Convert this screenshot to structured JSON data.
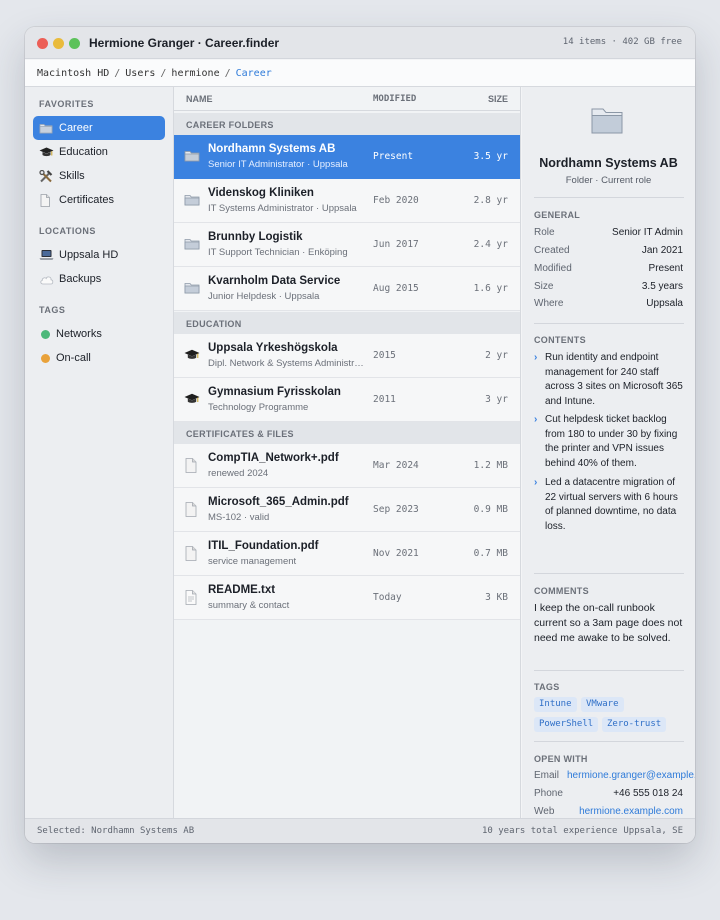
{
  "window": {
    "title": "Hermione Granger · Career.finder",
    "meta": "14 items · 402 GB free"
  },
  "path": {
    "segments": [
      "Macintosh HD",
      "Users",
      "hermione"
    ],
    "current": "Career"
  },
  "sidebar": {
    "favorites_label": "FAVORITES",
    "favorites": [
      {
        "label": "Career",
        "icon": "folder-icon"
      },
      {
        "label": "Education",
        "icon": "graduation-cap-icon"
      },
      {
        "label": "Skills",
        "icon": "tools-icon"
      },
      {
        "label": "Certificates",
        "icon": "document-icon"
      }
    ],
    "locations_label": "LOCATIONS",
    "locations": [
      {
        "label": "Uppsala HD",
        "icon": "laptop-icon"
      },
      {
        "label": "Backups",
        "icon": "cloud-icon"
      }
    ],
    "tags_label": "TAGS",
    "tags": [
      {
        "label": "Networks",
        "color": "#4cb87a"
      },
      {
        "label": "On-call",
        "color": "#e9a23b"
      }
    ]
  },
  "columns": {
    "name": "NAME",
    "modified": "MODIFIED",
    "size": "SIZE"
  },
  "sections": [
    {
      "label": "CAREER FOLDERS",
      "rows": [
        {
          "icon": "folder-icon",
          "name": "Nordhamn Systems AB",
          "sub": "Senior IT Administrator · Uppsala",
          "modified": "Present",
          "size": "3.5 yr"
        },
        {
          "icon": "folder-icon",
          "name": "Videnskog Kliniken",
          "sub": "IT Systems Administrator · Uppsala",
          "modified": "Feb 2020",
          "size": "2.8 yr"
        },
        {
          "icon": "folder-icon",
          "name": "Brunnby Logistik",
          "sub": "IT Support Technician · Enköping",
          "modified": "Jun 2017",
          "size": "2.4 yr"
        },
        {
          "icon": "folder-icon",
          "name": "Kvarnholm Data Service",
          "sub": "Junior Helpdesk · Uppsala",
          "modified": "Aug 2015",
          "size": "1.6 yr"
        }
      ]
    },
    {
      "label": "EDUCATION",
      "rows": [
        {
          "icon": "graduation-cap-icon",
          "name": "Uppsala Yrkeshögskola",
          "sub": "Dipl. Network & Systems Administration",
          "modified": "2015",
          "size": "2 yr"
        },
        {
          "icon": "graduation-cap-icon",
          "name": "Gymnasium Fyrisskolan",
          "sub": "Technology Programme",
          "modified": "2011",
          "size": "3 yr"
        }
      ]
    },
    {
      "label": "CERTIFICATES & FILES",
      "rows": [
        {
          "icon": "pdf-file-icon",
          "name": "CompTIA_Network+.pdf",
          "sub": "renewed 2024",
          "modified": "Mar 2024",
          "size": "1.2 MB"
        },
        {
          "icon": "pdf-file-icon",
          "name": "Microsoft_365_Admin.pdf",
          "sub": "MS-102 · valid",
          "modified": "Sep 2023",
          "size": "0.9 MB"
        },
        {
          "icon": "pdf-file-icon",
          "name": "ITIL_Foundation.pdf",
          "sub": "service management",
          "modified": "Nov 2021",
          "size": "0.7 MB"
        },
        {
          "icon": "text-file-icon",
          "name": "README.txt",
          "sub": "summary & contact",
          "modified": "Today",
          "size": "3 KB"
        }
      ]
    }
  ],
  "detail": {
    "title": "Nordhamn Systems AB",
    "subtitle": "Folder · Current role",
    "general_label": "GENERAL",
    "general": [
      {
        "k": "Role",
        "v": "Senior IT Admin"
      },
      {
        "k": "Created",
        "v": "Jan 2021"
      },
      {
        "k": "Modified",
        "v": "Present"
      },
      {
        "k": "Size",
        "v": "3.5 years"
      },
      {
        "k": "Where",
        "v": "Uppsala"
      }
    ],
    "contents_label": "CONTENTS",
    "contents": [
      "Run identity and endpoint management for 240 staff across 3 sites on Microsoft 365 and Intune.",
      "Cut helpdesk ticket backlog from 180 to under 30 by fixing the printer and VPN issues behind 40% of them.",
      "Led a datacentre migration of 22 virtual servers with 6 hours of planned downtime, no data loss."
    ],
    "comments_label": "COMMENTS",
    "comment": "I keep the on-call runbook current so a 3am page does not need me awake to be solved.",
    "tags_label": "TAGS",
    "tags": [
      "Intune",
      "VMware",
      "PowerShell",
      "Zero-trust"
    ],
    "open_with_label": "OPEN WITH",
    "open_with": [
      {
        "k": "Email",
        "v": "hermione.granger@example.com"
      },
      {
        "k": "Phone",
        "v": "+46 555 018 24"
      },
      {
        "k": "Web",
        "v": "hermione.example.com"
      }
    ]
  },
  "status": {
    "selected": "Selected: Nordhamn Systems AB",
    "experience": "10 years total experience",
    "location": "Uppsala, SE"
  }
}
